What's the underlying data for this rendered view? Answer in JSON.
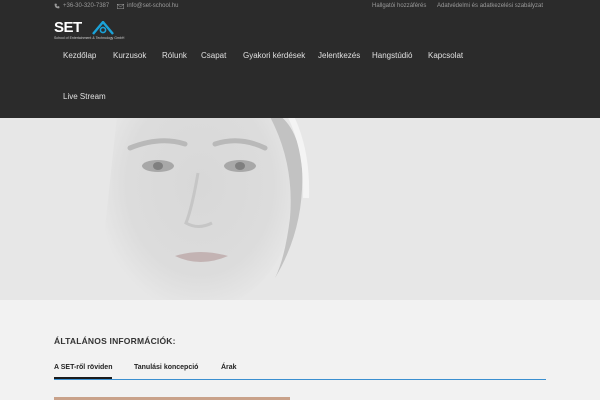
{
  "topbar": {
    "phone": "+36-30-320-7387",
    "email": "info@set-school.hu",
    "links": [
      "Hallgatói hozzáférés",
      "Adatvédelmi és adatkezelési szabályzat"
    ]
  },
  "logo": {
    "text": "SET",
    "subtitle": "School of Entertainment & Technology GmbH"
  },
  "nav": {
    "items": [
      "Kezdőlap",
      "Kurzusok",
      "Rólunk",
      "Csapat",
      "Gyakori kérdések",
      "Jelentkezés",
      "Hangstúdió",
      "Kapcsolat",
      "Live Stream"
    ]
  },
  "main": {
    "section_title": "ÁLTALÁNOS INFORMÁCIÓK:",
    "tabs": [
      {
        "label": "A SET-ről röviden",
        "active": true
      },
      {
        "label": "Tanulási koncepció",
        "active": false
      },
      {
        "label": "Árak",
        "active": false
      }
    ]
  },
  "colors": {
    "header_bg": "#2b2b2b",
    "accent": "#3a8fd0",
    "logo_accent": "#1aa3d9",
    "page_bg": "#f2f2f2"
  },
  "icons": [
    "phone-icon",
    "mail-icon"
  ]
}
